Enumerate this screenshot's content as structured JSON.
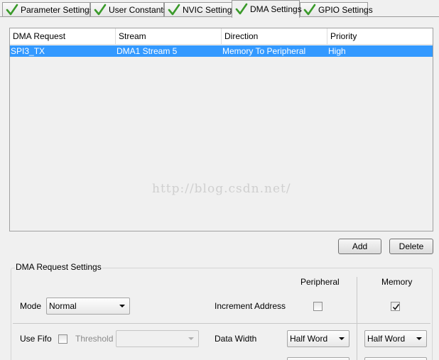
{
  "tabs": [
    {
      "label": "Parameter Settings",
      "active": false
    },
    {
      "label": "User Constants",
      "active": false
    },
    {
      "label": "NVIC Settings",
      "active": false
    },
    {
      "label": "DMA Settings",
      "active": true
    },
    {
      "label": "GPIO Settings",
      "active": false
    }
  ],
  "table": {
    "columns": [
      "DMA Request",
      "Stream",
      "Direction",
      "Priority"
    ],
    "rows": [
      {
        "request": "SPI3_TX",
        "stream": "DMA1 Stream 5",
        "direction": "Memory To Peripheral",
        "priority": "High",
        "selected": true
      }
    ]
  },
  "watermark": "http://blog.csdn.net/",
  "buttons": {
    "add": "Add",
    "delete": "Delete"
  },
  "settings": {
    "title": "DMA Request Settings",
    "peripheral_header": "Peripheral",
    "memory_header": "Memory",
    "mode_label": "Mode",
    "mode_value": "Normal",
    "increment_label": "Increment Address",
    "peripheral_increment": false,
    "memory_increment": true,
    "use_fifo_label": "Use Fifo",
    "use_fifo": false,
    "threshold_label": "Threshold",
    "threshold_value": "",
    "data_width_label": "Data Width",
    "peripheral_data_width": "Half Word",
    "memory_data_width": "Half Word"
  },
  "colors": {
    "selection": "#3399ff",
    "check": "#3a9a2a"
  }
}
